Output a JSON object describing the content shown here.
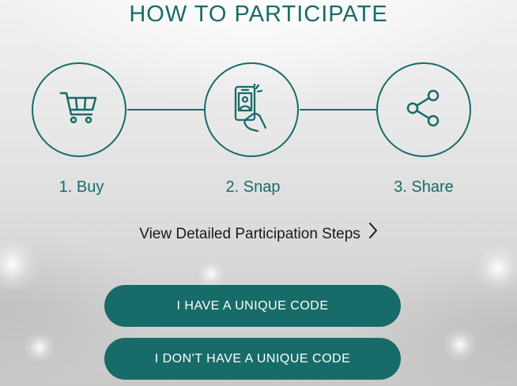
{
  "header": {
    "title": "HOW TO PARTICIPATE"
  },
  "steps": [
    {
      "label": "1. Buy",
      "icon": "shopping-cart-icon"
    },
    {
      "label": "2. Snap",
      "icon": "phone-camera-icon"
    },
    {
      "label": "3. Share",
      "icon": "share-icon"
    }
  ],
  "detail_link": {
    "label": "View Detailed Participation Steps",
    "icon": "chevron-right-icon"
  },
  "actions": {
    "have_code_label": "I HAVE A UNIQUE CODE",
    "no_code_label": "I DON'T HAVE A UNIQUE CODE"
  },
  "colors": {
    "brand_teal": "#176b68",
    "text_dark": "#1a1a1a",
    "button_text": "#ffffff"
  }
}
